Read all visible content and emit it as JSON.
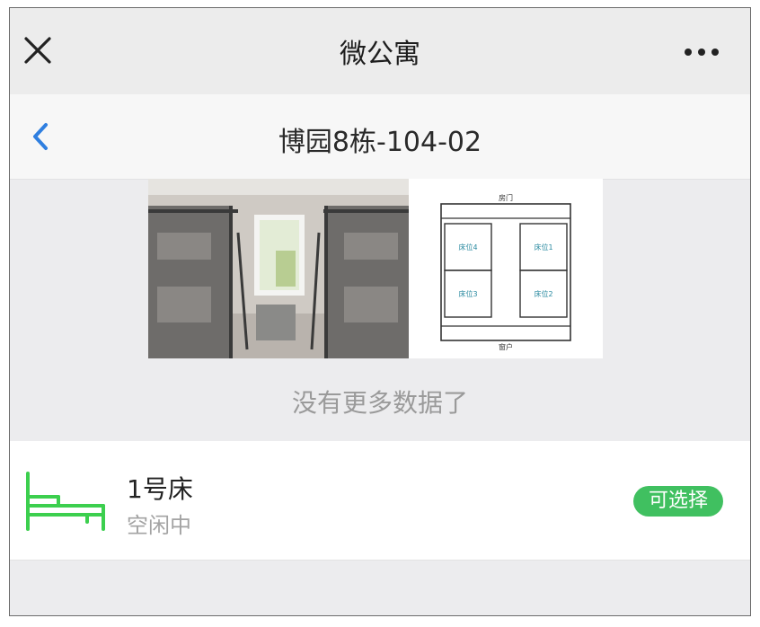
{
  "app": {
    "title": "微公寓"
  },
  "nav": {
    "title": "博园8栋-104-02"
  },
  "room_plan": {
    "top_label": "房门",
    "bottom_label": "窗户",
    "beds": [
      "床位4",
      "床位1",
      "床位3",
      "床位2"
    ]
  },
  "list": {
    "end_text": "没有更多数据了"
  },
  "beds": [
    {
      "name": "1号床",
      "status": "空闲中",
      "action": "可选择"
    }
  ],
  "colors": {
    "accent_green": "#40c060",
    "back_blue": "#2f7fe0"
  }
}
